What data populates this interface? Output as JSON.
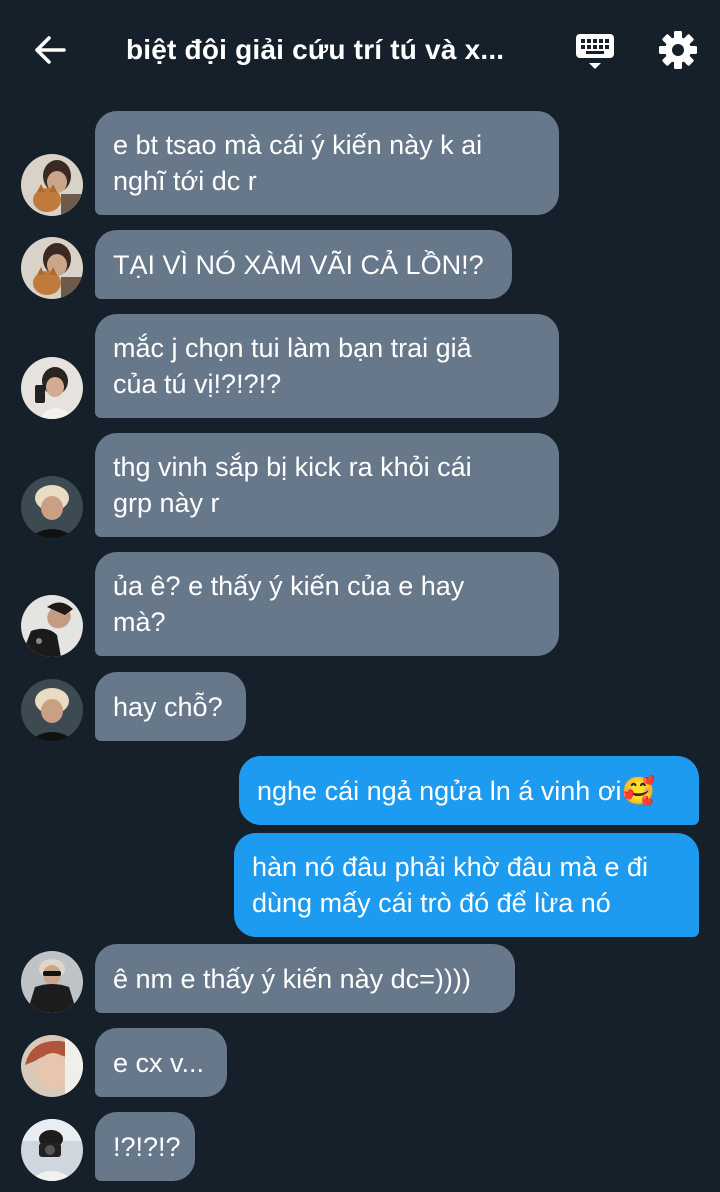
{
  "header": {
    "title": "biệt đội giải cứu trí tú và x...",
    "back_icon": "arrow-left-icon",
    "keyboard_icon": "keyboard-icon",
    "settings_icon": "gear-icon"
  },
  "colors": {
    "background": "#15202b",
    "received_bubble": "#67788a",
    "sent_bubble": "#1d9bf0"
  },
  "messages": [
    {
      "side": "received",
      "text": "e bt tsao mà cái ý kiến này k ai\nnghĩ tới dc r",
      "avatar": "avatar-cat-boy"
    },
    {
      "side": "received",
      "text": "TẠI VÌ NÓ XÀM VÃI CẢ LỒN!?",
      "avatar": "avatar-cat-boy"
    },
    {
      "side": "received",
      "text": "mắc j chọn tui làm bạn trai giả\ncủa tú vị!?!?!?",
      "avatar": "avatar-mirror-selfie"
    },
    {
      "side": "received",
      "text": "thg vinh sắp bị kick ra khỏi cái\ngrp này r",
      "avatar": "avatar-blond"
    },
    {
      "side": "received",
      "text": "ủa ê? e thấy ý kiến của e hay\nmà?",
      "avatar": "avatar-tilted"
    },
    {
      "side": "received",
      "text": "hay chỗ?",
      "avatar": "avatar-blond"
    },
    {
      "side": "sent",
      "text": "nghe cái ngả ngửa ln á vinh ơi🥰"
    },
    {
      "side": "sent",
      "text": "hàn nó đâu phải khờ đâu mà e đi\ndùng mấy cái trò đó để lừa nó"
    },
    {
      "side": "received",
      "text": "ê nm e thấy ý kiến này dc=))))",
      "avatar": "avatar-sunglasses"
    },
    {
      "side": "received",
      "text": "e cx v...",
      "avatar": "avatar-redhair"
    },
    {
      "side": "received",
      "text": "!?!?!?",
      "avatar": "avatar-camera"
    }
  ]
}
